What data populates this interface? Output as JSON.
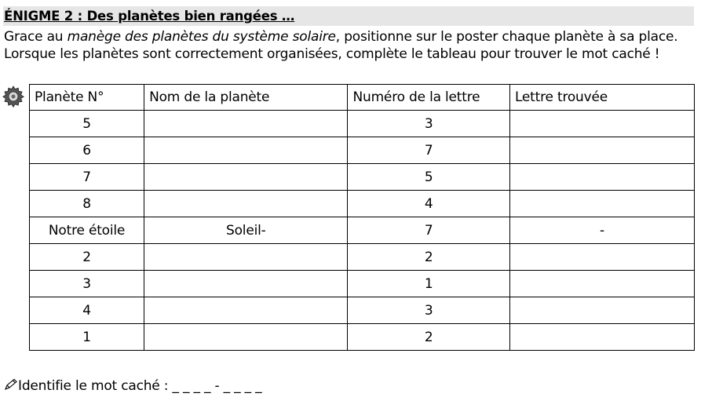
{
  "title": "ÉNIGME 2 : Des planètes bien rangées …",
  "intro": {
    "part1": "Grace au ",
    "italic": "manège des planètes du système solaire",
    "part2": ", positionne sur le poster chaque planète à sa place. Lorsque les planètes sont correctement organisées, complète le tableau pour trouver le mot caché !"
  },
  "table": {
    "headers": [
      "Planète N°",
      "Nom de la planète",
      "Numéro de la lettre",
      "Lettre trouvée"
    ],
    "rows": [
      [
        "5",
        "",
        "3",
        ""
      ],
      [
        "6",
        "",
        "7",
        ""
      ],
      [
        "7",
        "",
        "5",
        ""
      ],
      [
        "8",
        "",
        "4",
        ""
      ],
      [
        "Notre étoile",
        "Soleil-",
        "7",
        "-"
      ],
      [
        "2",
        "",
        "2",
        ""
      ],
      [
        "3",
        "",
        "1",
        ""
      ],
      [
        "4",
        "",
        "3",
        ""
      ],
      [
        "1",
        "",
        "2",
        ""
      ]
    ]
  },
  "footer": {
    "label": "Identifie le mot caché : ",
    "blanks": "_ _ _ _ - _ _ _ _"
  },
  "icons": {
    "gear": "gear-icon",
    "pencil": "pencil-icon"
  }
}
